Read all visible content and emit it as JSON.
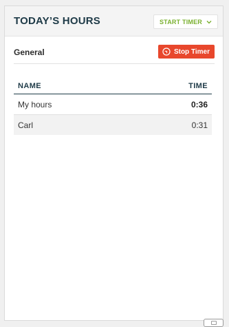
{
  "header": {
    "title": "TODAY’S HOURS",
    "start_timer_label": "START TIMER",
    "start_timer_icon": "chevron-down-icon"
  },
  "section": {
    "title": "General",
    "stop_timer_label": "Stop Timer",
    "stop_timer_icon": "stop-timer-icon"
  },
  "table": {
    "columns": [
      "NAME",
      "TIME"
    ],
    "rows": [
      {
        "name": "My hours",
        "time": "0:36"
      },
      {
        "name": "Carl",
        "time": "0:31"
      }
    ]
  },
  "colors": {
    "title": "#1e3a47",
    "start_timer": "#7ab02f",
    "stop_timer": "#e8472c",
    "alt_row": "#f2f2f2"
  }
}
